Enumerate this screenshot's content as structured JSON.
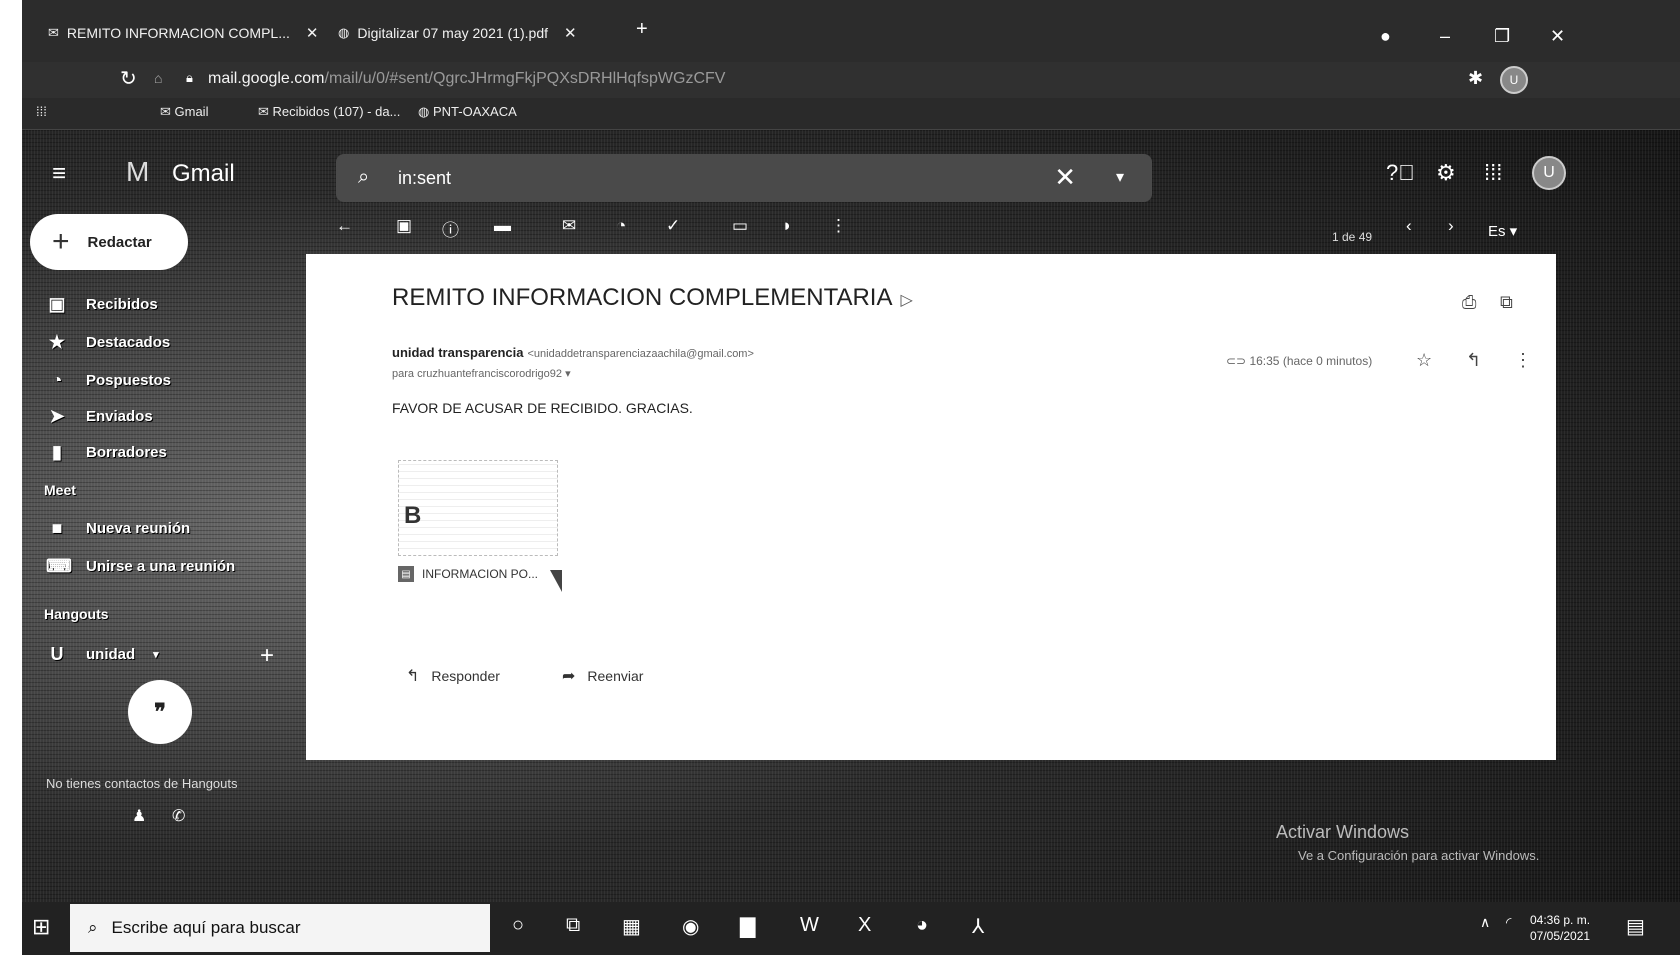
{
  "browser": {
    "tabs": [
      {
        "label": "REMITO INFORMACION COMPL..."
      },
      {
        "label": "Digitalizar 07 may 2021 (1).pdf"
      }
    ],
    "address_host": "mail.google.com",
    "address_path": "/mail/u/0/#sent/QgrcJHrmgFkjPQXsDRHlHqfspWGzCFV",
    "bookmarks": [
      "Gmail",
      "Recibidos (107) - da...",
      "PNT-OAXACA"
    ]
  },
  "gmail": {
    "logo": "Gmail",
    "search_value": "in:sent",
    "compose_label": "Redactar",
    "nav": [
      "Recibidos",
      "Destacados",
      "Pospuestos",
      "Enviados",
      "Borradores"
    ],
    "meet_section": "Meet",
    "meet_items": [
      "Nueva reunión",
      "Unirse a una reunión"
    ],
    "hangouts_section": "Hangouts",
    "hangouts_user": "unidad",
    "hangouts_empty": "No tienes contactos de Hangouts",
    "pager": "1 de 49",
    "lang": "Es",
    "avatar_initial": "U"
  },
  "message": {
    "subject": "REMITO INFORMACION COMPLEMENTARIA",
    "sender_name": "unidad transparencia",
    "sender_email": "<unidaddetransparenciazaachila@gmail.com>",
    "to": "para cruzhuantefranciscorodrigo92",
    "time": "16:35 (hace 0 minutos)",
    "body": "FAVOR DE ACUSAR DE RECIBIDO. GRACIAS.",
    "attachment_preview": "B",
    "attachment_name": "INFORMACION PO...",
    "reply_label": "Responder",
    "forward_label": "Reenviar"
  },
  "windows": {
    "activate_line1": "Activar Windows",
    "activate_line2": "Ve a Configuración para activar Windows.",
    "search_placeholder": "Escribe aquí para buscar",
    "clock_time": "04:36 p. m.",
    "clock_date": "07/05/2021"
  }
}
